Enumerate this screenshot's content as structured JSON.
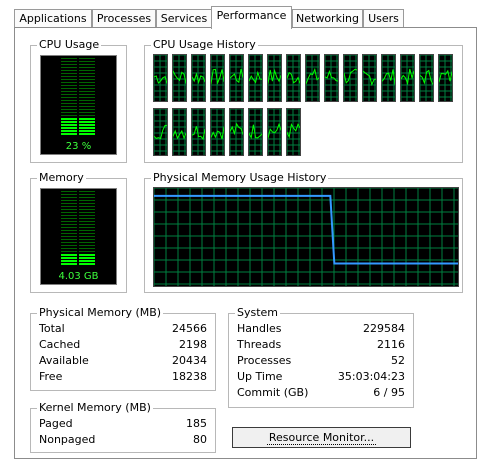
{
  "tabs": [
    {
      "label": "Applications",
      "active": false
    },
    {
      "label": "Processes",
      "active": false
    },
    {
      "label": "Services",
      "active": false
    },
    {
      "label": "Performance",
      "active": true
    },
    {
      "label": "Networking",
      "active": false
    },
    {
      "label": "Users",
      "active": false
    }
  ],
  "cpu": {
    "title": "CPU Usage",
    "value": "23 %",
    "percent": 23,
    "history_title": "CPU Usage History",
    "history_cores": 24
  },
  "memory": {
    "title": "Memory",
    "value": "4.03 GB",
    "used_fraction": 0.164,
    "history_title": "Physical Memory Usage History"
  },
  "physical_memory": {
    "title": "Physical Memory (MB)",
    "rows": [
      {
        "label": "Total",
        "value": "24566"
      },
      {
        "label": "Cached",
        "value": "2198"
      },
      {
        "label": "Available",
        "value": "20434"
      },
      {
        "label": "Free",
        "value": "18238"
      }
    ]
  },
  "kernel_memory": {
    "title": "Kernel Memory (MB)",
    "rows": [
      {
        "label": "Paged",
        "value": "185"
      },
      {
        "label": "Nonpaged",
        "value": "80"
      }
    ]
  },
  "system": {
    "title": "System",
    "rows": [
      {
        "label": "Handles",
        "value": "229584"
      },
      {
        "label": "Threads",
        "value": "2116"
      },
      {
        "label": "Processes",
        "value": "52"
      },
      {
        "label": "Up Time",
        "value": "35:03:04:23"
      },
      {
        "label": "Commit (GB)",
        "value": "6 / 95"
      }
    ]
  },
  "resource_monitor_label": "Resource Monitor...",
  "colors": {
    "graph_background": "#000000",
    "grid": "#008040",
    "cpu_line": "#00ff00",
    "memory_line": "#3399ff",
    "meter_lit": "#00ff00",
    "meter_dim": "#006400"
  }
}
